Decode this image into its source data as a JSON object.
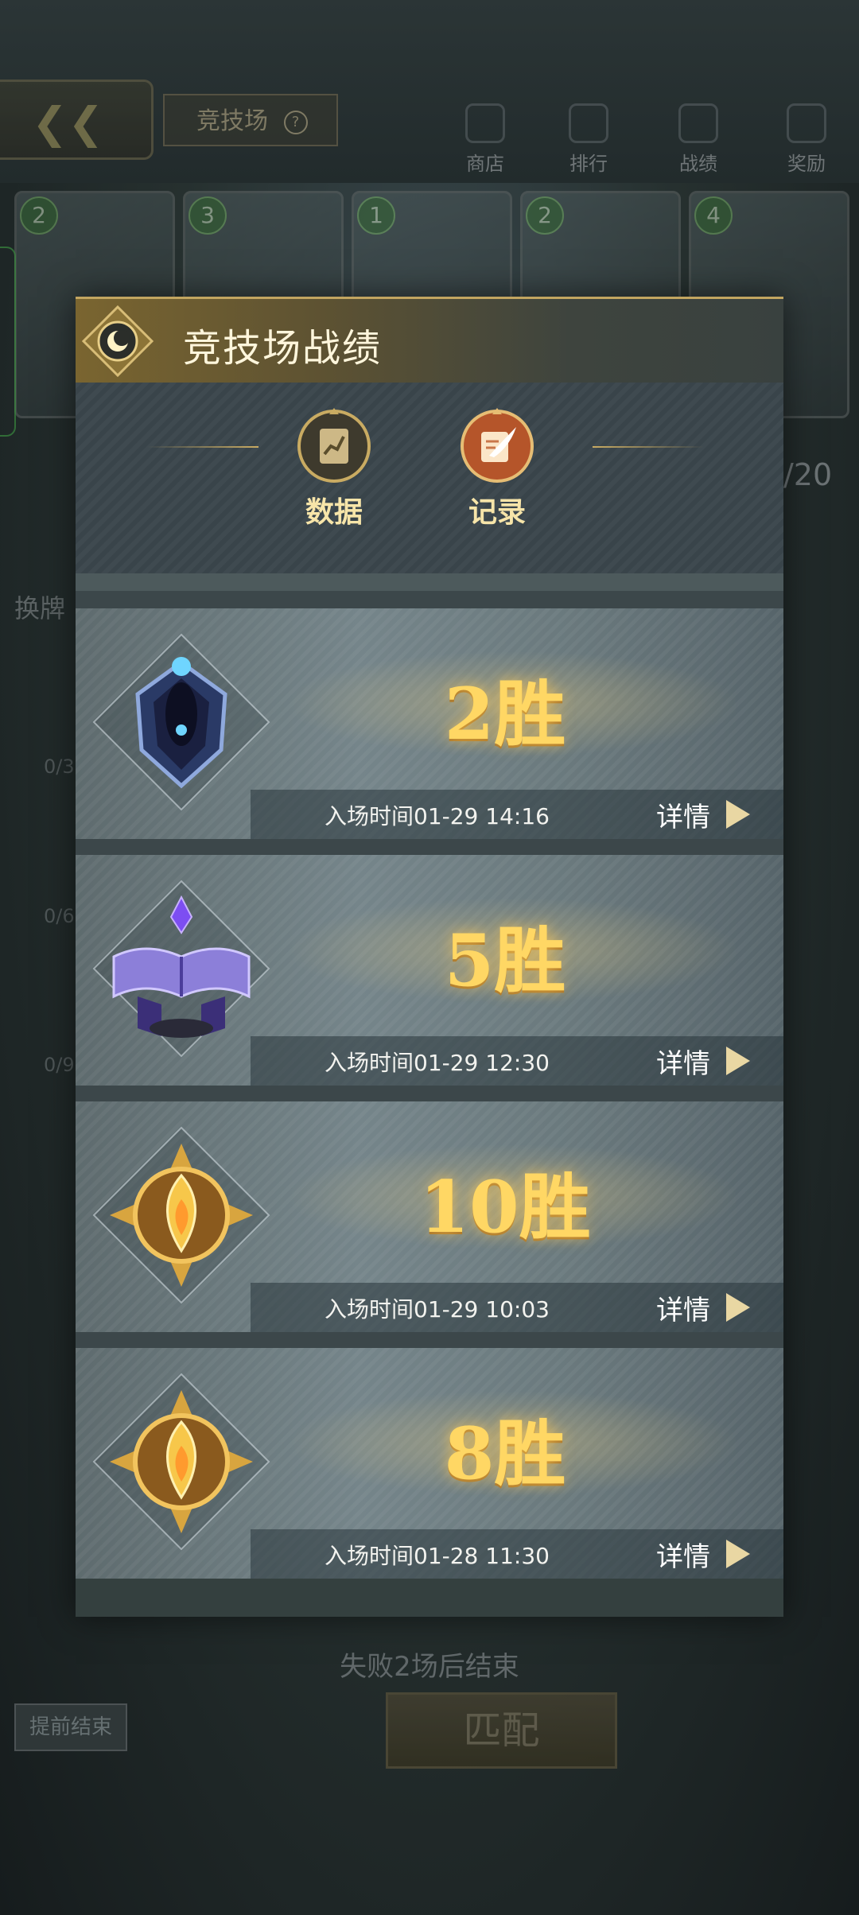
{
  "background": {
    "arena_tab_label": "竞技场",
    "nav": [
      {
        "label": "商店",
        "icon": "shop-icon"
      },
      {
        "label": "排行",
        "icon": "trophy-icon"
      },
      {
        "label": "战绩",
        "icon": "record-icon"
      },
      {
        "label": "奖励",
        "icon": "reward-icon"
      }
    ],
    "card_costs": [
      "2",
      "3",
      "1",
      "2",
      "4"
    ],
    "card_count": "/20",
    "switch_label": "换牌",
    "lock_values": [
      "0/3",
      "0/6",
      "0/9"
    ],
    "fail_text": "失败2场后结束",
    "match_button": "匹配",
    "early_end_button": "提前结束"
  },
  "modal": {
    "title": "竞技场战绩",
    "tabs": [
      {
        "label": "数据",
        "icon": "data-chart-icon"
      },
      {
        "label": "记录",
        "icon": "record-quill-icon"
      }
    ],
    "records": [
      {
        "wins": "2胜",
        "time_text": "入场时间01-29 14:16",
        "detail_label": "详情",
        "emblem": "blue-crest"
      },
      {
        "wins": "5胜",
        "time_text": "入场时间01-29 12:30",
        "detail_label": "详情",
        "emblem": "purple-book"
      },
      {
        "wins": "10胜",
        "time_text": "入场时间01-29 10:03",
        "detail_label": "详情",
        "emblem": "gold-flame"
      },
      {
        "wins": "8胜",
        "time_text": "入场时间01-28 11:30",
        "detail_label": "详情",
        "emblem": "gold-flame"
      }
    ]
  },
  "colors": {
    "gold": "#ffd764",
    "header_gold": "#7a6530",
    "tab_label": "#f7e5a9"
  }
}
